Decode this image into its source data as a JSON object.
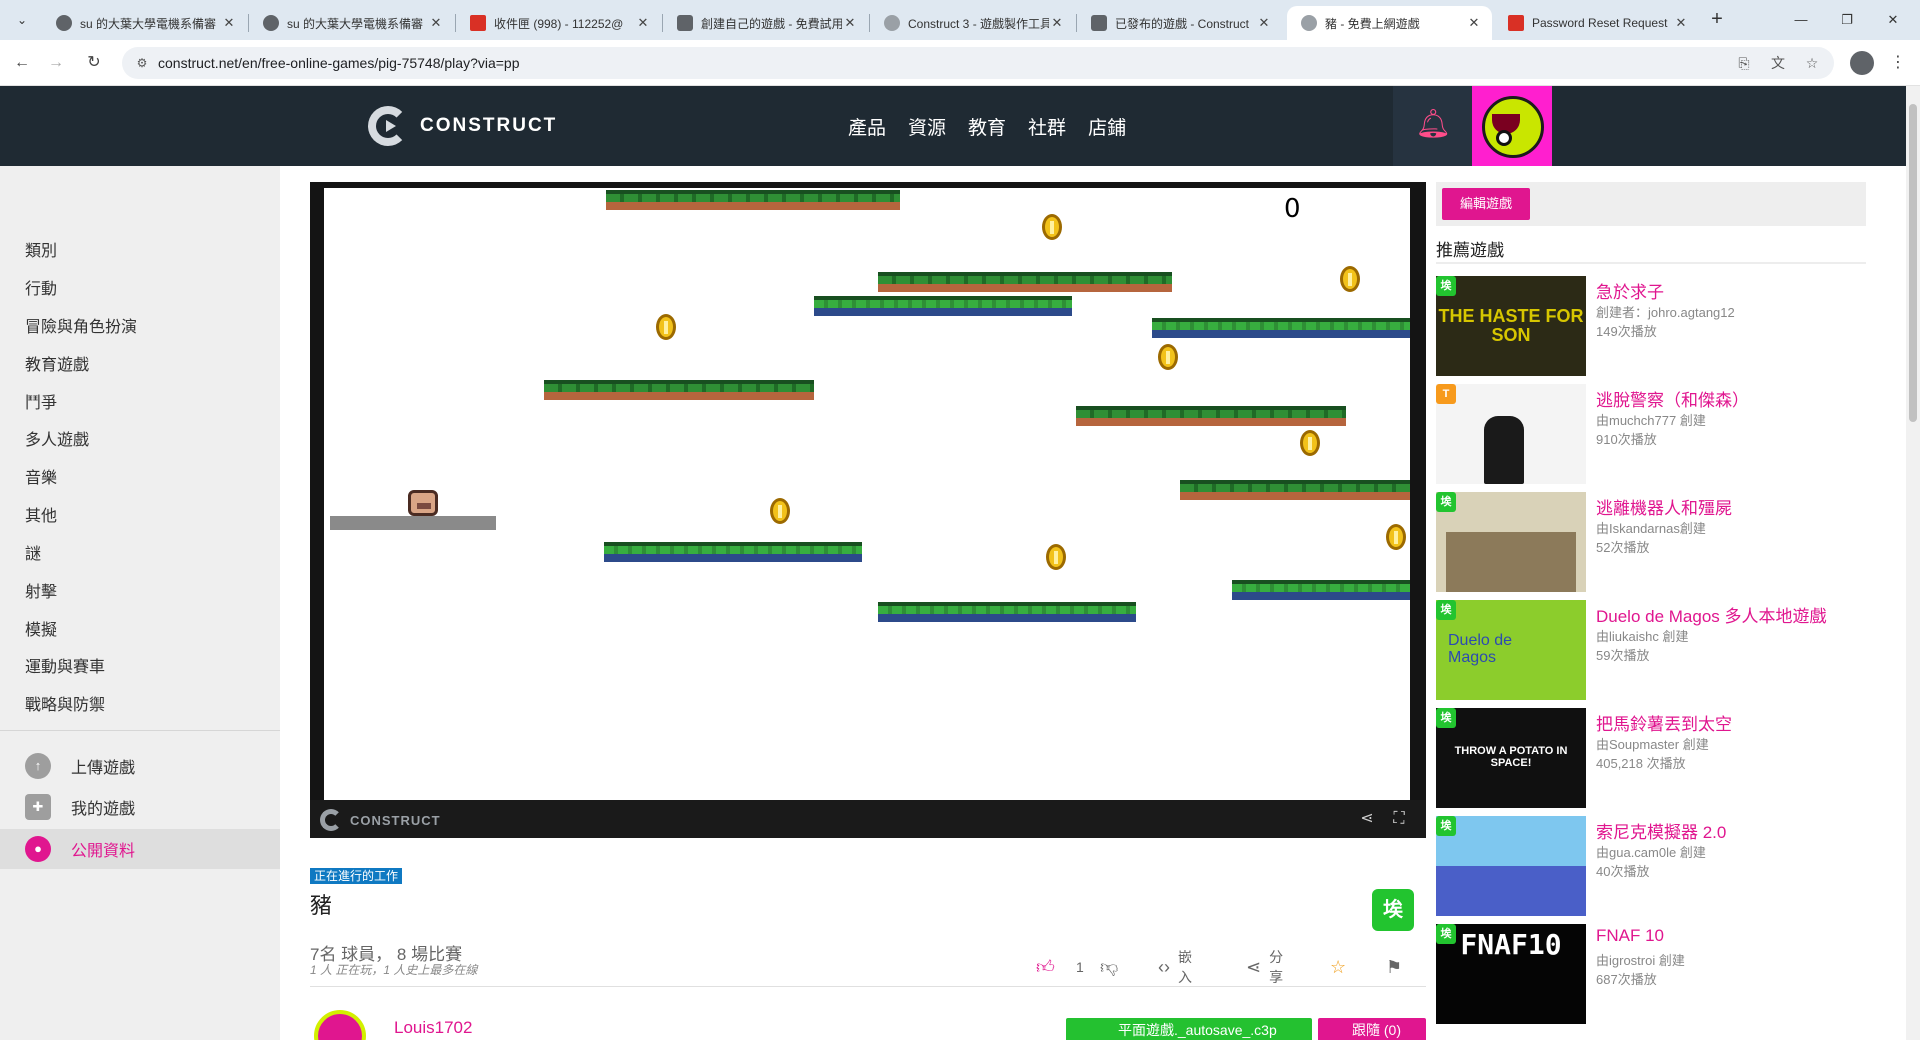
{
  "browser": {
    "tabs": [
      {
        "title": "su 的大葉大學電機系備審",
        "favicon_color": "#5f6368"
      },
      {
        "title": "su 的大葉大學電機系備審",
        "favicon_color": "#5f6368"
      },
      {
        "title": "收件匣 (998) - 112252@",
        "favicon_color": "#d93025"
      },
      {
        "title": "創建自己的遊戲 - 免費試用",
        "favicon_color": "#5f6368"
      },
      {
        "title": "Construct 3 - 遊戲製作工具",
        "favicon_color": "#9aa0a6"
      },
      {
        "title": "已發布的遊戲 - Construct",
        "favicon_color": "#5f6368"
      },
      {
        "title": "豬 - 免費上網遊戲",
        "favicon_color": "#9aa0a6",
        "active": true
      },
      {
        "title": "Password Reset Request",
        "favicon_color": "#d93025"
      }
    ],
    "url": "construct.net/en/free-online-games/pig-75748/play?via=pp"
  },
  "site": {
    "logo_text": "CONSTRUCT",
    "nav": [
      "產品",
      "資源",
      "教育",
      "社群",
      "店鋪"
    ]
  },
  "sidebar": {
    "categories": [
      "類別",
      "行動",
      "冒險與角色扮演",
      "教育遊戲",
      "鬥爭",
      "多人遊戲",
      "音樂",
      "其他",
      "謎",
      "射擊",
      "模擬",
      "運動與賽車",
      "戰略與防禦"
    ],
    "links": [
      {
        "label": "上傳遊戲",
        "icon": "cloud-upload-icon"
      },
      {
        "label": "我的遊戲",
        "icon": "gamepad-icon"
      },
      {
        "label": "公開資料",
        "icon": "user-circle-icon",
        "active": true
      }
    ]
  },
  "game": {
    "score": "0",
    "bar_brand": "CONSTRUCT",
    "wip_badge": "正在進行的工作",
    "title": "豬",
    "title_icon": "埃",
    "stats": "7名 球員， 8 場比賽",
    "stats_sub": "1 人 正在玩，1 人史上最多在線",
    "likes": "1",
    "embed_label": "嵌入",
    "share_label": "分享",
    "author": "Louis1702",
    "green_button": "平面遊戲._autosave_.c3p",
    "follow_button": "跟隨 (0)"
  },
  "right": {
    "edit_button": "編輯遊戲",
    "recommended_title": "推薦遊戲",
    "items": [
      {
        "name": "急於求子",
        "by": "創建者：johro.agtang12",
        "plays": "149次播放",
        "badge": "埃",
        "thumb_text": "THE HASTE FOR SON"
      },
      {
        "name": "逃脫警察（和傑森）",
        "by": "由muchch777 創建",
        "plays": "910次播放",
        "badge": "T",
        "thumb_text": ""
      },
      {
        "name": "逃離機器人和殭屍",
        "by": "由Iskandarnas創建",
        "plays": "52次播放",
        "badge": "埃",
        "thumb_text": ""
      },
      {
        "name": "Duelo de Magos 多人本地遊戲",
        "by": "由liukaishc 創建",
        "plays": "59次播放",
        "badge": "埃",
        "thumb_text": "Duelo de Magos"
      },
      {
        "name": "把馬鈴薯丟到太空",
        "by": "由Soupmaster 創建",
        "plays": "405,218 次播放",
        "badge": "埃",
        "thumb_text": "THROW A POTATO IN SPACE!"
      },
      {
        "name": "索尼克模擬器 2.0",
        "by": "由gua.cam0le 創建",
        "plays": "40次播放",
        "badge": "埃",
        "thumb_text": ""
      },
      {
        "name": "FNAF 10",
        "by": "由igrostroi 創建",
        "plays": "687次播放",
        "badge": "埃",
        "thumb_text": "FNAF10"
      }
    ]
  }
}
